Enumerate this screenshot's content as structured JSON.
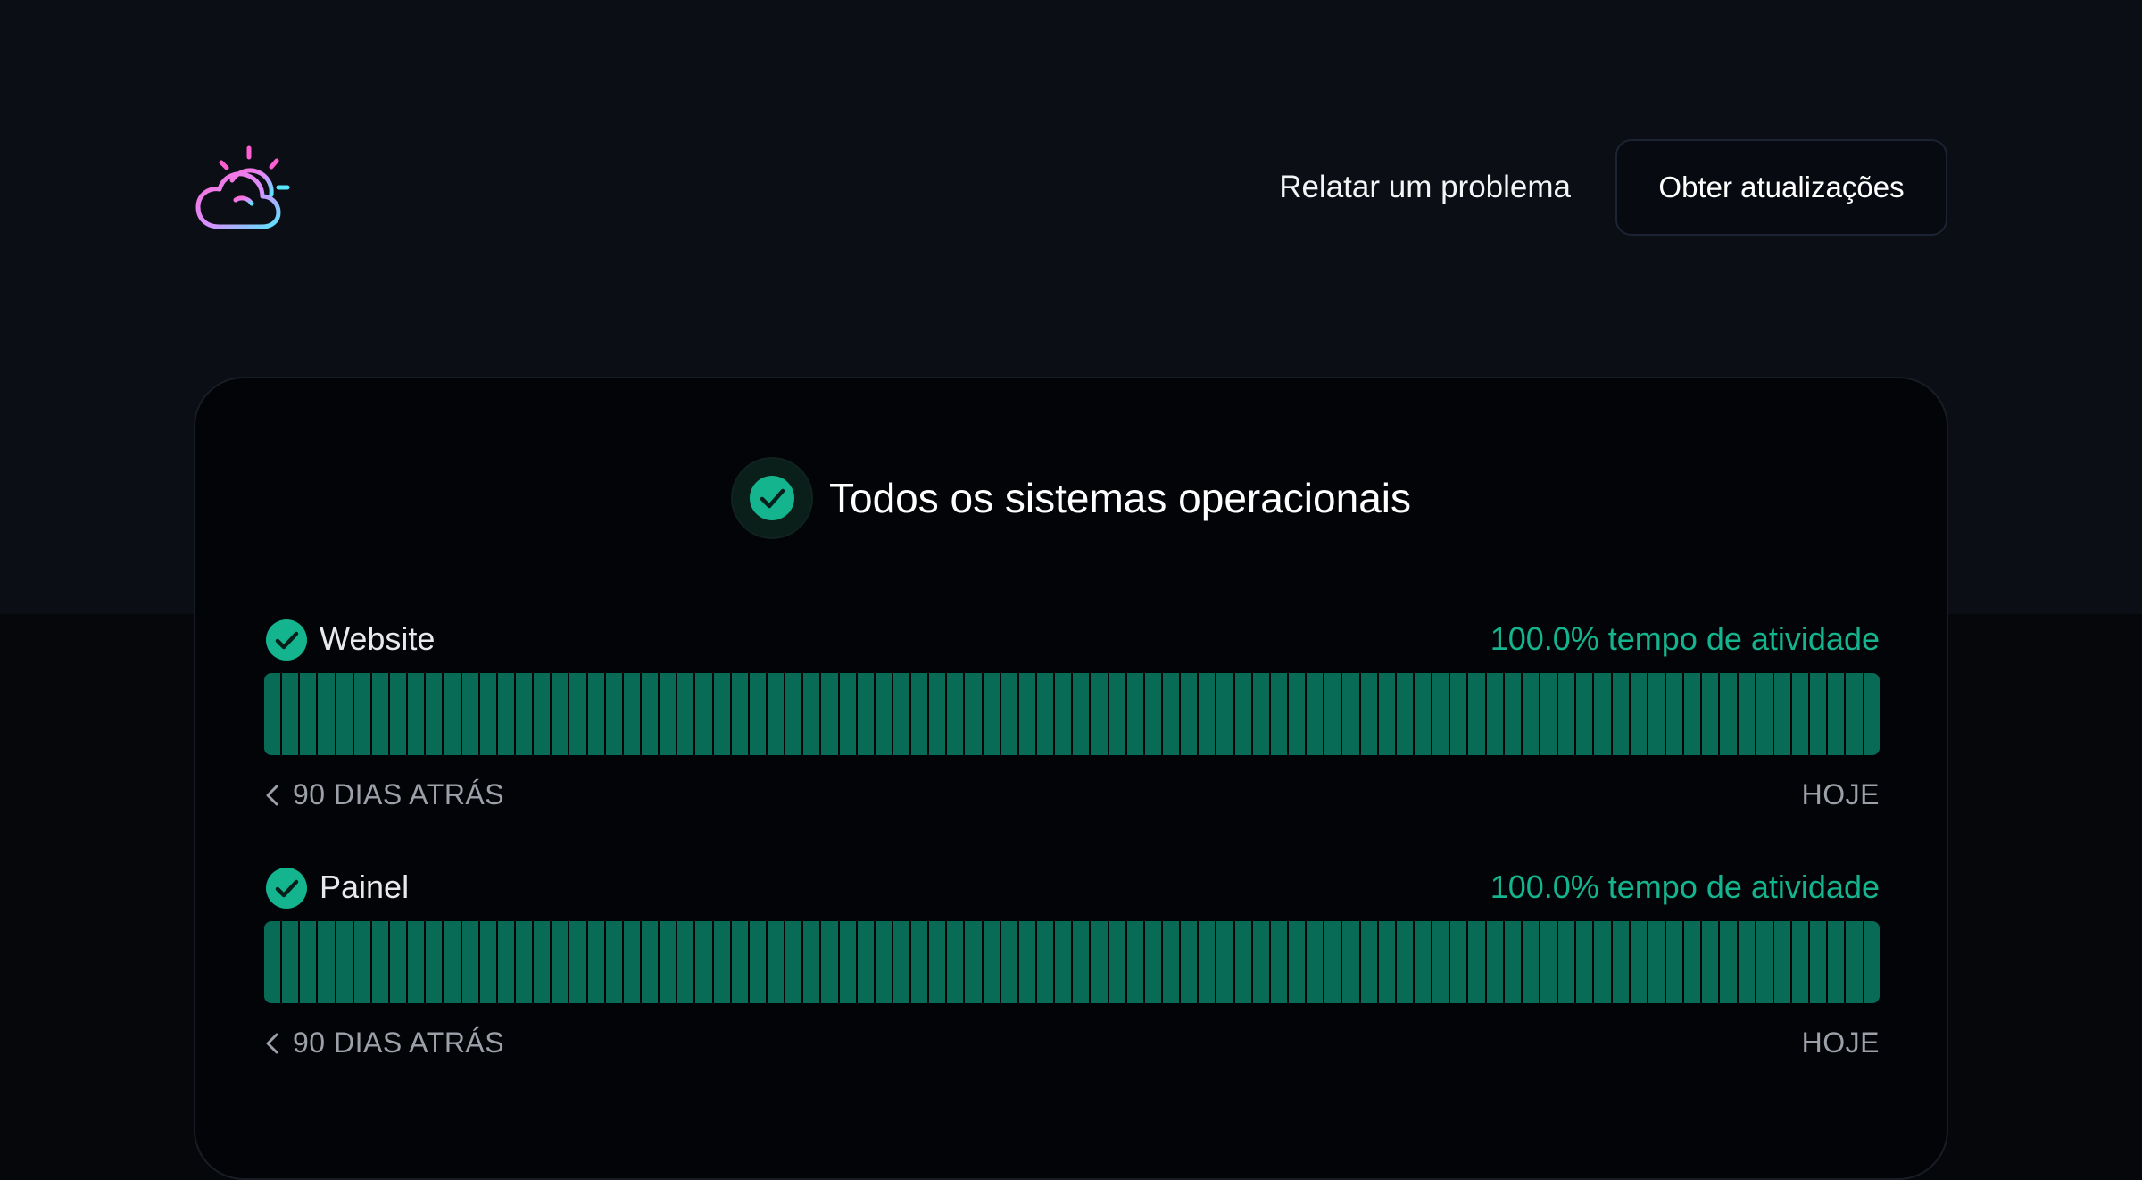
{
  "brand": {
    "logo_icon": "cloud-sun-icon",
    "colors": {
      "cloud_gradient_start": "#ff6ad5",
      "cloud_gradient_end": "#58e6ff",
      "sun_rays": "#ff5fd0"
    }
  },
  "header": {
    "report_link": "Relatar um problema",
    "subscribe_button": "Obter atualizações"
  },
  "status": {
    "overall_icon": "check-circle-icon",
    "overall_text": "Todos os sistemas operacionais"
  },
  "components": [
    {
      "name": "Website",
      "status_icon": "check-circle-icon",
      "uptime_label": "100.0% tempo de atividade",
      "uptime_percent": 100.0,
      "days": 90,
      "range_start": "90 DIAS ATRÁS",
      "range_end": "HOJE"
    },
    {
      "name": "Painel",
      "status_icon": "check-circle-icon",
      "uptime_label": "100.0% tempo de atividade",
      "uptime_percent": 100.0,
      "days": 90,
      "range_start": "90 DIAS ATRÁS",
      "range_end": "HOJE"
    }
  ],
  "colors": {
    "background": "#05070b",
    "header_band": "#0b0e14",
    "card": "#030408",
    "operational_green": "#14b58e",
    "bar_green": "#076b55",
    "muted_text": "#9ca0a8"
  }
}
